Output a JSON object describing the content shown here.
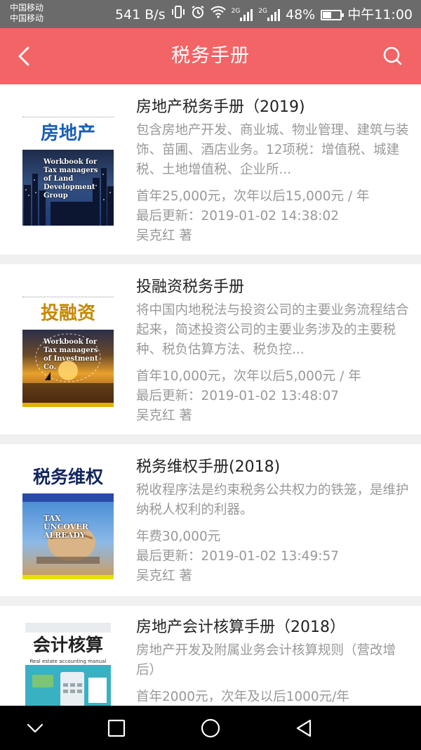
{
  "status_bar": {
    "carrier_1": "中国移动",
    "carrier_2": "中国移动",
    "speed": "541 B/s",
    "net_1": "2G",
    "net_2": "2G",
    "battery": "48%",
    "battery_level": 0.48,
    "time": "中午11:00"
  },
  "app_bar": {
    "title": "税务手册",
    "back_icon": "back-icon",
    "search_icon": "search-icon",
    "bg_color": "#f26466"
  },
  "books": [
    {
      "title": "房地产税务手册（2019)",
      "cover_title": "房地产",
      "cover_title_color": "#1a5fb4",
      "cover_english": "Workbook for Tax managers of Land Development Group",
      "description": "包含房地产开发、商业城、物业管理、建筑与装饰、苗圃、酒店业务。12项税：增值税、城建税、土地增值税、企业所...",
      "price": "首年25,000元，次年以后15,000元 / 年",
      "updated": "最后更新：2019-01-02 14:38:02",
      "author": "吴克红 著"
    },
    {
      "title": "投融资税务手册",
      "cover_title": "投融资",
      "cover_title_color": "#c48a00",
      "cover_english": "Workbook for Tax managers of Investment Co.",
      "description": "将中国内地税法与投资公司的主要业务流程结合起来，简述投资公司的主要业务涉及的主要税种、税负估算方法、税负控...",
      "price": "首年10,000元，次年以后5,000元 / 年",
      "updated": "最后更新：2019-01-02 13:48:07",
      "author": "吴克红 著"
    },
    {
      "title": "税务维权手册(2018)",
      "cover_title": "税务维权",
      "cover_title_color": "#12265e",
      "cover_english": "TAX UNCOVER ALREADY",
      "description": "税收程序法是约束税务公共权力的铁笼，是维护纳税人权利的利器。",
      "price": "年费30,000元",
      "updated": "最后更新：2019-01-02 13:49:57",
      "author": "吴克红 著"
    },
    {
      "title": "房地产会计核算手册（2018）",
      "cover_title": "会计核算",
      "cover_title_color": "#222222",
      "cover_subtitle": "Real estate accounting manual",
      "description": "房地产开发及附属业务会计核算规则（营改增后）",
      "price": "首年2000元，次年及以后1000元/年",
      "updated": "",
      "author": ""
    }
  ],
  "nav_bar": {
    "icons": [
      "chevron-down-icon",
      "square-icon",
      "circle-icon",
      "triangle-back-icon"
    ]
  }
}
